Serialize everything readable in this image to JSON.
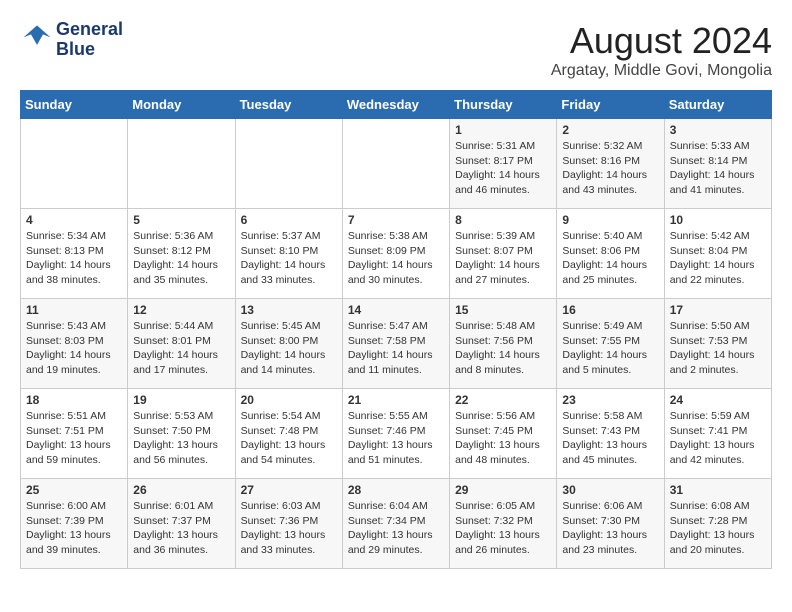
{
  "header": {
    "logo_line1": "General",
    "logo_line2": "Blue",
    "month": "August 2024",
    "location": "Argatay, Middle Govi, Mongolia"
  },
  "days_of_week": [
    "Sunday",
    "Monday",
    "Tuesday",
    "Wednesday",
    "Thursday",
    "Friday",
    "Saturday"
  ],
  "weeks": [
    [
      {
        "day": "",
        "info": ""
      },
      {
        "day": "",
        "info": ""
      },
      {
        "day": "",
        "info": ""
      },
      {
        "day": "",
        "info": ""
      },
      {
        "day": "1",
        "info": "Sunrise: 5:31 AM\nSunset: 8:17 PM\nDaylight: 14 hours\nand 46 minutes."
      },
      {
        "day": "2",
        "info": "Sunrise: 5:32 AM\nSunset: 8:16 PM\nDaylight: 14 hours\nand 43 minutes."
      },
      {
        "day": "3",
        "info": "Sunrise: 5:33 AM\nSunset: 8:14 PM\nDaylight: 14 hours\nand 41 minutes."
      }
    ],
    [
      {
        "day": "4",
        "info": "Sunrise: 5:34 AM\nSunset: 8:13 PM\nDaylight: 14 hours\nand 38 minutes."
      },
      {
        "day": "5",
        "info": "Sunrise: 5:36 AM\nSunset: 8:12 PM\nDaylight: 14 hours\nand 35 minutes."
      },
      {
        "day": "6",
        "info": "Sunrise: 5:37 AM\nSunset: 8:10 PM\nDaylight: 14 hours\nand 33 minutes."
      },
      {
        "day": "7",
        "info": "Sunrise: 5:38 AM\nSunset: 8:09 PM\nDaylight: 14 hours\nand 30 minutes."
      },
      {
        "day": "8",
        "info": "Sunrise: 5:39 AM\nSunset: 8:07 PM\nDaylight: 14 hours\nand 27 minutes."
      },
      {
        "day": "9",
        "info": "Sunrise: 5:40 AM\nSunset: 8:06 PM\nDaylight: 14 hours\nand 25 minutes."
      },
      {
        "day": "10",
        "info": "Sunrise: 5:42 AM\nSunset: 8:04 PM\nDaylight: 14 hours\nand 22 minutes."
      }
    ],
    [
      {
        "day": "11",
        "info": "Sunrise: 5:43 AM\nSunset: 8:03 PM\nDaylight: 14 hours\nand 19 minutes."
      },
      {
        "day": "12",
        "info": "Sunrise: 5:44 AM\nSunset: 8:01 PM\nDaylight: 14 hours\nand 17 minutes."
      },
      {
        "day": "13",
        "info": "Sunrise: 5:45 AM\nSunset: 8:00 PM\nDaylight: 14 hours\nand 14 minutes."
      },
      {
        "day": "14",
        "info": "Sunrise: 5:47 AM\nSunset: 7:58 PM\nDaylight: 14 hours\nand 11 minutes."
      },
      {
        "day": "15",
        "info": "Sunrise: 5:48 AM\nSunset: 7:56 PM\nDaylight: 14 hours\nand 8 minutes."
      },
      {
        "day": "16",
        "info": "Sunrise: 5:49 AM\nSunset: 7:55 PM\nDaylight: 14 hours\nand 5 minutes."
      },
      {
        "day": "17",
        "info": "Sunrise: 5:50 AM\nSunset: 7:53 PM\nDaylight: 14 hours\nand 2 minutes."
      }
    ],
    [
      {
        "day": "18",
        "info": "Sunrise: 5:51 AM\nSunset: 7:51 PM\nDaylight: 13 hours\nand 59 minutes."
      },
      {
        "day": "19",
        "info": "Sunrise: 5:53 AM\nSunset: 7:50 PM\nDaylight: 13 hours\nand 56 minutes."
      },
      {
        "day": "20",
        "info": "Sunrise: 5:54 AM\nSunset: 7:48 PM\nDaylight: 13 hours\nand 54 minutes."
      },
      {
        "day": "21",
        "info": "Sunrise: 5:55 AM\nSunset: 7:46 PM\nDaylight: 13 hours\nand 51 minutes."
      },
      {
        "day": "22",
        "info": "Sunrise: 5:56 AM\nSunset: 7:45 PM\nDaylight: 13 hours\nand 48 minutes."
      },
      {
        "day": "23",
        "info": "Sunrise: 5:58 AM\nSunset: 7:43 PM\nDaylight: 13 hours\nand 45 minutes."
      },
      {
        "day": "24",
        "info": "Sunrise: 5:59 AM\nSunset: 7:41 PM\nDaylight: 13 hours\nand 42 minutes."
      }
    ],
    [
      {
        "day": "25",
        "info": "Sunrise: 6:00 AM\nSunset: 7:39 PM\nDaylight: 13 hours\nand 39 minutes."
      },
      {
        "day": "26",
        "info": "Sunrise: 6:01 AM\nSunset: 7:37 PM\nDaylight: 13 hours\nand 36 minutes."
      },
      {
        "day": "27",
        "info": "Sunrise: 6:03 AM\nSunset: 7:36 PM\nDaylight: 13 hours\nand 33 minutes."
      },
      {
        "day": "28",
        "info": "Sunrise: 6:04 AM\nSunset: 7:34 PM\nDaylight: 13 hours\nand 29 minutes."
      },
      {
        "day": "29",
        "info": "Sunrise: 6:05 AM\nSunset: 7:32 PM\nDaylight: 13 hours\nand 26 minutes."
      },
      {
        "day": "30",
        "info": "Sunrise: 6:06 AM\nSunset: 7:30 PM\nDaylight: 13 hours\nand 23 minutes."
      },
      {
        "day": "31",
        "info": "Sunrise: 6:08 AM\nSunset: 7:28 PM\nDaylight: 13 hours\nand 20 minutes."
      }
    ]
  ]
}
